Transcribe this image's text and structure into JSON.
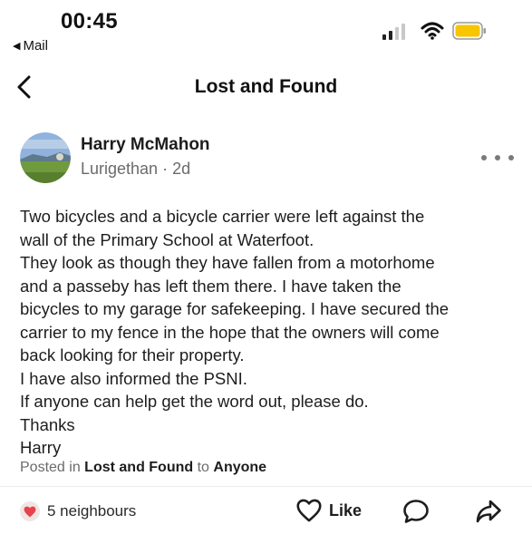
{
  "status_bar": {
    "time": "00:45",
    "back_app": "Mail",
    "battery_color": "#F7C600"
  },
  "nav": {
    "title": "Lost and Found"
  },
  "post": {
    "author": "Harry McMahon",
    "location": "Lurigethan",
    "age": "2d",
    "body_lines": [
      "Two bicycles and a bicycle carrier were left against the",
      "wall of the Primary School at Waterfoot.",
      "They look as though they have fallen from a motorhome",
      "and a passeby has left them there. I have taken the",
      "bicycles to my garage for safekeeping. I have secured the",
      "carrier to my fence in the hope that the owners will come",
      "back looking for their property.",
      "I have also informed the PSNI.",
      "If anyone can help get the word out, please do.",
      "Thanks",
      "Harry"
    ],
    "posted_in_prefix": "Posted in",
    "group": "Lost and Found",
    "to_word": "to",
    "audience": "Anyone"
  },
  "footer": {
    "reactions": "5 neighbours",
    "like_label": "Like",
    "reaction_color": "#E8424B"
  },
  "icons": {
    "back": "chevron-left-icon",
    "more": "more-horizontal-icon",
    "reaction": "heart-icon",
    "like": "heart-outline-icon",
    "comment": "comment-bubble-icon",
    "share": "share-arrow-icon"
  }
}
